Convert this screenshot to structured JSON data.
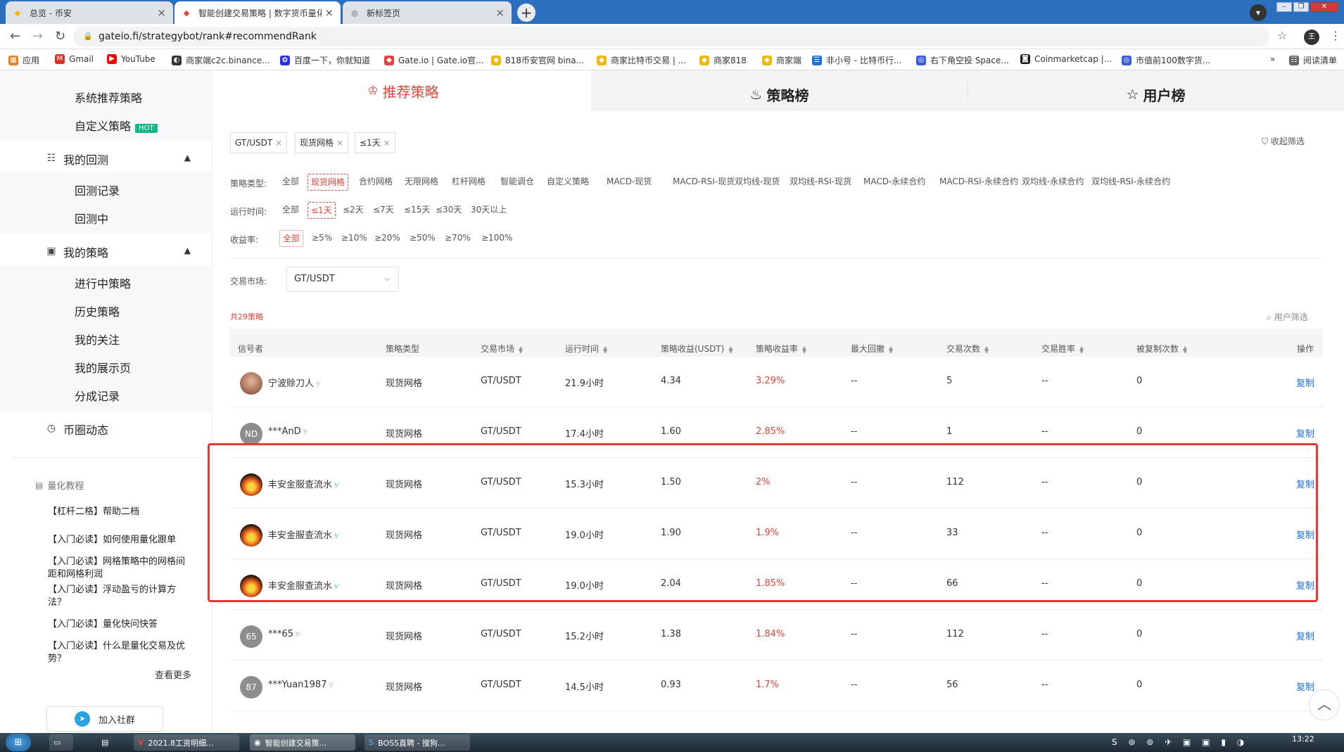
{
  "browser": {
    "tabs": [
      {
        "title": "总览 - 币安",
        "icon": "binance-icon"
      },
      {
        "title": "智能创建交易策略 | 数字货币量化",
        "icon": "gate-icon"
      },
      {
        "title": "新标签页",
        "icon": "chrome-icon"
      }
    ],
    "url": "gateio.fi/strategybot/rank#recommendRank",
    "bookmarks": [
      "应用",
      "Gmail",
      "YouTube",
      "商家端c2c.binance...",
      "百度一下，你就知道",
      "Gate.io | Gate.io官...",
      "818币安官网 bina...",
      "商家比特币交易 | ...",
      "商家818",
      "商家端",
      "非小号 - 比特币行...",
      "右下角空投 Space...",
      "Coinmarketcap |...",
      "市值前100数字货..."
    ],
    "reading_list": "阅读清单"
  },
  "sidebar": {
    "items_top": [
      "系统推荐策略",
      "自定义策略"
    ],
    "hot_badge": "HOT",
    "group_backtest": "我的回测",
    "backtest_items": [
      "回测记录",
      "回测中"
    ],
    "group_strategy": "我的策略",
    "strategy_items": [
      "进行中策略",
      "历史策略",
      "我的关注",
      "我的展示页",
      "分成记录"
    ],
    "group_feed": "币圈动态",
    "tutorial_title": "量化教程",
    "tutorials": [
      "【杠杆二格】帮助二档",
      "【入门必读】如何使用量化跟单",
      "【入门必读】网格策略中的网格间距和网格利润",
      "【入门必读】浮动盈亏的计算方法？",
      "【入门必读】量化快问快答",
      "【入门必读】什么是量化交易及优势？"
    ],
    "more": "查看更多",
    "join": "加入社群"
  },
  "main": {
    "tabs": [
      "推荐策略",
      "策略榜",
      "用户榜"
    ],
    "chips": [
      "GT/USDT",
      "现货网格",
      "≤1天"
    ],
    "collapse": "收起筛选",
    "type_label": "策略类型:",
    "types": [
      "全部",
      "现货网格",
      "合约网格",
      "无限网格",
      "杠杆网格",
      "智能调仓",
      "自定义策略",
      "MACD-现货",
      "MACD-RSI-现货",
      "双均线-现货",
      "双均线-RSI-现货",
      "MACD-永续合约",
      "MACD-RSI-永续合约",
      "双均线-永续合约",
      "双均线-RSI-永续合约"
    ],
    "time_label": "运行时间:",
    "times": [
      "全部",
      "≤1天",
      "≤2天",
      "≤7天",
      "≤15天",
      "≤30天",
      "30天以上"
    ],
    "yield_label": "收益率:",
    "yields": [
      "全部",
      "≥5%",
      "≥10%",
      "≥20%",
      "≥50%",
      "≥70%",
      "≥100%"
    ],
    "market_label": "交易市场:",
    "market_value": "GT/USDT",
    "count_text": "共29策略",
    "user_filter": "用户筛选",
    "headers": [
      "信号者",
      "策略类型",
      "交易市场",
      "运行时间",
      "策略收益(USDT)",
      "策略收益率",
      "最大回撤",
      "交易次数",
      "交易胜率",
      "被复制次数",
      "操作"
    ],
    "rows": [
      {
        "name": "宁波赊刀人",
        "avatar": "photo",
        "type": "现货网格",
        "market": "GT/USDT",
        "time": "21.9小时",
        "profit": "4.34",
        "rate": "3.29%",
        "drawdown": "--",
        "trades": "5",
        "win": "--",
        "copied": "0",
        "action": "复制"
      },
      {
        "name": "***AnD",
        "avatar": "ND",
        "type": "现货网格",
        "market": "GT/USDT",
        "time": "17.4小时",
        "profit": "1.60",
        "rate": "2.85%",
        "drawdown": "--",
        "trades": "1",
        "win": "--",
        "copied": "0",
        "action": "复制"
      },
      {
        "name": "丰安金服查流水",
        "avatar": "flame",
        "type": "现货网格",
        "market": "GT/USDT",
        "time": "15.3小时",
        "profit": "1.50",
        "rate": "2%",
        "drawdown": "--",
        "trades": "112",
        "win": "--",
        "copied": "0",
        "action": "复制"
      },
      {
        "name": "丰安金服查流水",
        "avatar": "flame",
        "type": "现货网格",
        "market": "GT/USDT",
        "time": "19.0小时",
        "profit": "1.90",
        "rate": "1.9%",
        "drawdown": "--",
        "trades": "33",
        "win": "--",
        "copied": "0",
        "action": "复制"
      },
      {
        "name": "丰安金服查流水",
        "avatar": "flame",
        "type": "现货网格",
        "market": "GT/USDT",
        "time": "19.0小时",
        "profit": "2.04",
        "rate": "1.85%",
        "drawdown": "--",
        "trades": "66",
        "win": "--",
        "copied": "0",
        "action": "复制"
      },
      {
        "name": "***65",
        "avatar": "65",
        "type": "现货网格",
        "market": "GT/USDT",
        "time": "15.2小时",
        "profit": "1.38",
        "rate": "1.84%",
        "drawdown": "--",
        "trades": "112",
        "win": "--",
        "copied": "0",
        "action": "复制"
      },
      {
        "name": "***Yuan1987",
        "avatar": "87",
        "type": "现货网格",
        "market": "GT/USDT",
        "time": "14.5小时",
        "profit": "0.93",
        "rate": "1.7%",
        "drawdown": "--",
        "trades": "56",
        "win": "--",
        "copied": "0",
        "action": "复制"
      }
    ]
  },
  "taskbar": {
    "items": [
      "2021.8工资明细...",
      "智能创建交易策...",
      "BOSS直聘 - 搜狗..."
    ],
    "clock": "13:22"
  },
  "colors": {
    "accent_red": "#e0453a",
    "link_blue": "#1e6fd9",
    "tab_blue": "#2c6fbf"
  }
}
